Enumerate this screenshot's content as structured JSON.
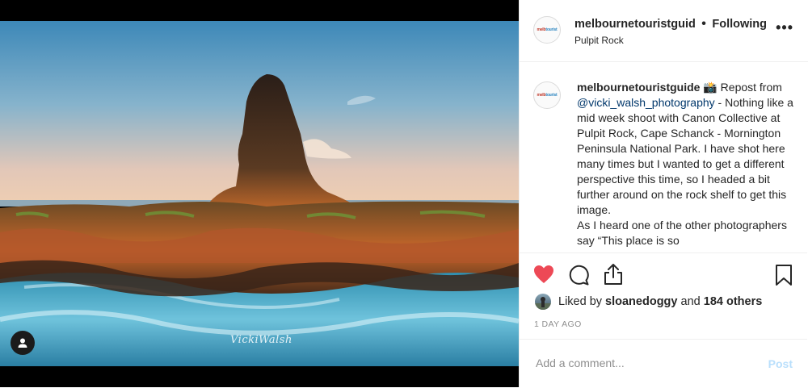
{
  "header": {
    "username": "melbournetouristguid",
    "separator": "•",
    "follow_status": "Following",
    "location": "Pulpit Rock",
    "more_label": "•••"
  },
  "media": {
    "watermark": "VickiWalsh"
  },
  "caption": {
    "username": "melbournetouristguide",
    "emoji": "📸",
    "lead": " Repost from ",
    "mention": "@vicki_walsh_photography",
    "body": " - Nothing like a mid week shoot with Canon Collective at Pulpit Rock, Cape Schanck - Mornington Peninsula National Park. I have shot here many times but I wanted to get a different perspective this time, so I headed a bit further around on the rock shelf to get this image.",
    "body2": "As I heard one of the other photographers say “This place is so"
  },
  "likes": {
    "prefix": "Liked by ",
    "user": "sloanedoggy",
    "middle": " and ",
    "others": "184 others"
  },
  "timestamp": "1 DAY AGO",
  "comment": {
    "placeholder": "Add a comment...",
    "post_label": "Post"
  },
  "colors": {
    "like_red": "#ed4956",
    "post_disabled": "#b9dffc",
    "mention_blue": "#00376b"
  },
  "icons": [
    "heart-icon",
    "comment-icon",
    "share-icon",
    "bookmark-icon",
    "more-options-icon",
    "user-tag-icon"
  ]
}
